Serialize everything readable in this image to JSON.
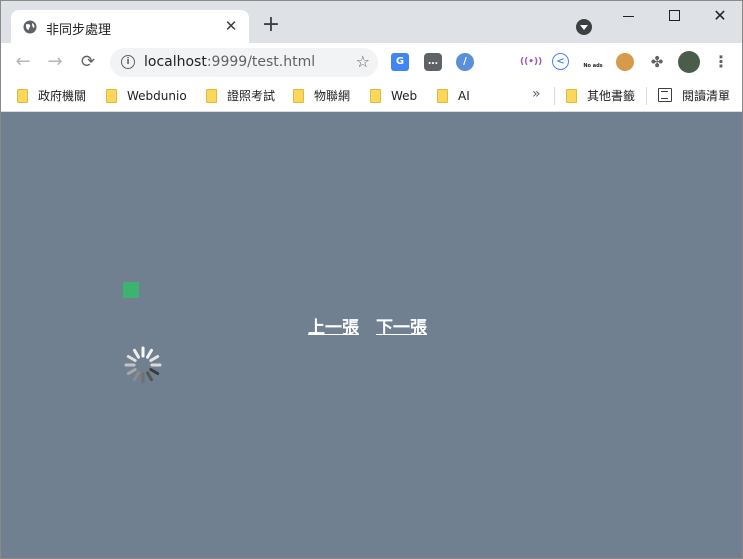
{
  "tab": {
    "title": "非同步處理",
    "close": "✕"
  },
  "newtab": "+",
  "window": {
    "close": "✕"
  },
  "toolbar": {
    "url_host": "localhost",
    "url_rest": ":9999/test.html",
    "ext_noads": "No ads"
  },
  "bookmarks": {
    "items": [
      "政府機關",
      "Webdunio",
      "證照考試",
      "物聯網",
      "Web",
      "AI"
    ],
    "other": "其他書籤",
    "reading": "閱讀清單"
  },
  "content": {
    "prev": "上一張",
    "next": "下一張"
  }
}
